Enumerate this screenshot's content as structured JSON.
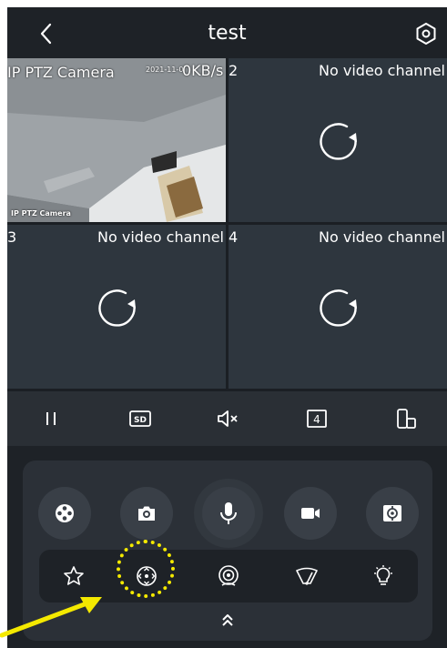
{
  "header": {
    "title": "test",
    "back_icon": "chevron-left-icon",
    "settings_icon": "settings-icon"
  },
  "channels": [
    {
      "label": "IP PTZ Camera",
      "timestamp": "2021-11-0",
      "bitrate": "0KB/s",
      "osd": "IP PTZ Camera",
      "status": ""
    },
    {
      "label": "2",
      "status": "No video channel"
    },
    {
      "label": "3",
      "status": "No video channel"
    },
    {
      "label": "4",
      "status": "No video channel"
    }
  ],
  "toolbar": {
    "items": [
      "pause-icon",
      "sd-quality-icon",
      "mute-icon",
      "split-4-icon",
      "rotate-screen-icon"
    ],
    "sd_label": "SD",
    "split_label": "4"
  },
  "controls": {
    "top_row": [
      "film-reel-icon",
      "snapshot-camera-icon",
      "microphone-icon",
      "video-record-icon",
      "ptz-target-icon"
    ],
    "bottom_row": [
      "favorite-star-icon",
      "ptz-direction-icon",
      "cruise-view-icon",
      "wiper-icon",
      "light-bulb-icon"
    ],
    "expand_icon": "double-chevron-up-icon"
  },
  "colors": {
    "background": "#1e2227",
    "panel": "#2b3037",
    "cell": "#2e363e",
    "highlight": "#f4e900"
  }
}
